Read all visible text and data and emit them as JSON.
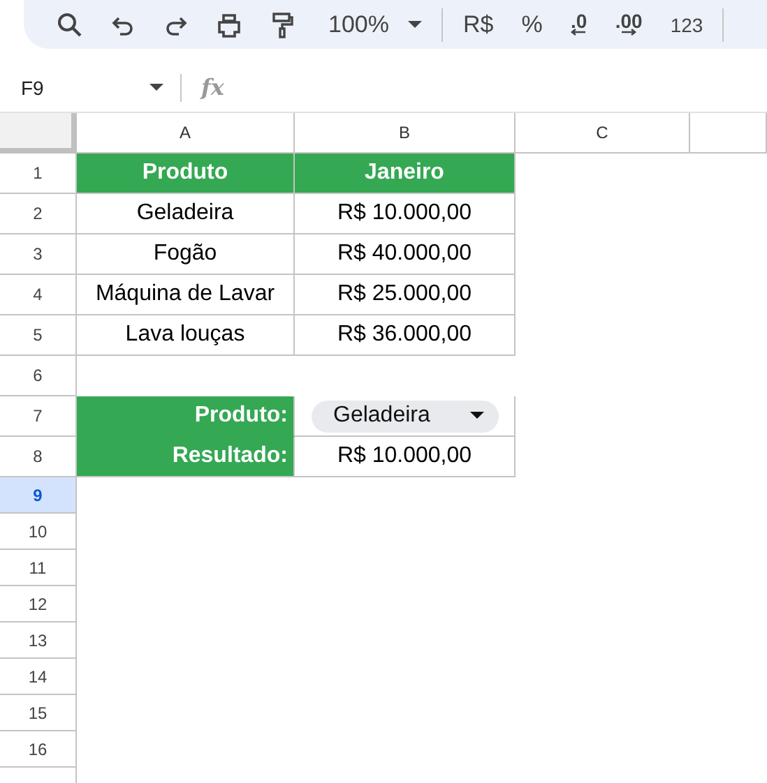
{
  "toolbar": {
    "zoom": "100%",
    "currency": "R$",
    "percent": "%",
    "decrease_decimals": ".0",
    "increase_decimals": ".00",
    "more_formats": "123"
  },
  "name_box": "F9",
  "formula_label": "fx",
  "columns": [
    "A",
    "B",
    "C"
  ],
  "rows": [
    {
      "number": "1",
      "selected": false,
      "cells": [
        {
          "kind": "header",
          "text": "Produto"
        },
        {
          "kind": "header",
          "text": "Janeiro"
        }
      ]
    },
    {
      "number": "2",
      "selected": false,
      "cells": [
        {
          "kind": "text",
          "text": "Geladeira"
        },
        {
          "kind": "text",
          "text": "R$ 10.000,00"
        }
      ]
    },
    {
      "number": "3",
      "selected": false,
      "cells": [
        {
          "kind": "text",
          "text": "Fogão"
        },
        {
          "kind": "text",
          "text": "R$ 40.000,00"
        }
      ]
    },
    {
      "number": "4",
      "selected": false,
      "cells": [
        {
          "kind": "text",
          "text": "Máquina de Lavar"
        },
        {
          "kind": "text",
          "text": "R$ 25.000,00"
        }
      ]
    },
    {
      "number": "5",
      "selected": false,
      "cells": [
        {
          "kind": "text",
          "text": "Lava louças"
        },
        {
          "kind": "text",
          "text": "R$ 36.000,00"
        }
      ]
    },
    {
      "number": "6",
      "selected": false
    },
    {
      "number": "7",
      "selected": false,
      "cells": [
        {
          "kind": "label",
          "text": "Produto:"
        },
        {
          "kind": "dropdown",
          "text": "Geladeira"
        }
      ]
    },
    {
      "number": "8",
      "selected": false,
      "cells": [
        {
          "kind": "label",
          "text": "Resultado:"
        },
        {
          "kind": "text",
          "text": "R$ 10.000,00"
        }
      ]
    },
    {
      "number": "9",
      "selected": true
    },
    {
      "number": "10",
      "selected": false
    },
    {
      "number": "11",
      "selected": false
    },
    {
      "number": "12",
      "selected": false
    },
    {
      "number": "13",
      "selected": false
    },
    {
      "number": "14",
      "selected": false
    },
    {
      "number": "15",
      "selected": false
    },
    {
      "number": "16",
      "selected": false
    }
  ]
}
